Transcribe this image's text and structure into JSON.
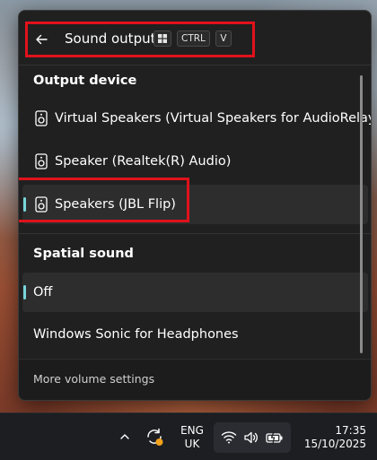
{
  "header": {
    "title": "Sound output",
    "back_icon": "arrow-left-icon",
    "shortcut": {
      "win_icon": "windows-logo-icon",
      "ctrl": "CTRL",
      "v": "V"
    }
  },
  "output_device": {
    "title": "Output device",
    "items": [
      {
        "label": "Virtual Speakers (Virtual Speakers for AudioRelay)",
        "icon": "speaker-icon",
        "selected": false
      },
      {
        "label": "Speaker (Realtek(R) Audio)",
        "icon": "speaker-icon",
        "selected": false
      },
      {
        "label": "Speakers (JBL Flip)",
        "icon": "speaker-icon",
        "selected": true
      }
    ]
  },
  "spatial_sound": {
    "title": "Spatial sound",
    "items": [
      {
        "label": "Off",
        "selected": true
      },
      {
        "label": "Windows Sonic for Headphones",
        "selected": false
      }
    ]
  },
  "footer": {
    "link": "More volume settings"
  },
  "taskbar": {
    "chevron_icon": "chevron-up-icon",
    "sync_icon": "sync-warning-icon",
    "language": {
      "line1": "ENG",
      "line2": "UK"
    },
    "wifi_icon": "wifi-icon",
    "volume_icon": "volume-icon",
    "battery_icon": "battery-charging-icon",
    "time": "17:35",
    "date": "15/10/2025"
  },
  "colors": {
    "accent": "#76d6dc",
    "highlight_box": "#e0121b",
    "panel_bg": "#202020"
  }
}
